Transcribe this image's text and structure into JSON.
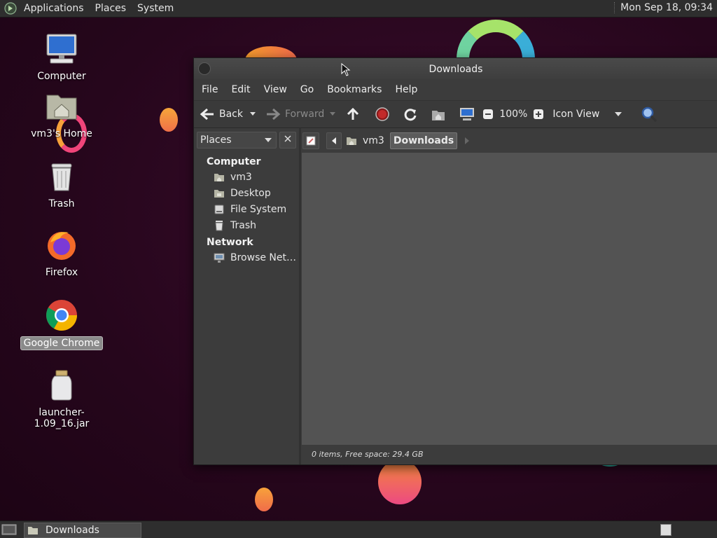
{
  "top_panel": {
    "menus": [
      "Applications",
      "Places",
      "System"
    ],
    "clock": "Mon Sep 18, 09:34"
  },
  "desktop": {
    "icons": [
      {
        "label": "Computer",
        "icon": "computer-icon"
      },
      {
        "label": "vm3's Home",
        "icon": "home-folder-icon"
      },
      {
        "label": "Trash",
        "icon": "trash-icon"
      },
      {
        "label": "Firefox",
        "icon": "firefox-icon"
      },
      {
        "label": "Google Chrome",
        "icon": "chrome-icon"
      },
      {
        "label": "launcher-1.09_16.jar",
        "icon": "jar-icon"
      }
    ]
  },
  "window": {
    "title": "Downloads",
    "menus": [
      "File",
      "Edit",
      "View",
      "Go",
      "Bookmarks",
      "Help"
    ],
    "toolbar": {
      "back": "Back",
      "forward": "Forward",
      "zoom": "100%",
      "view_mode": "Icon View"
    },
    "sidebar": {
      "selector": "Places",
      "sections": [
        {
          "heading": "Computer",
          "items": [
            "vm3",
            "Desktop",
            "File System",
            "Trash"
          ]
        },
        {
          "heading": "Network",
          "items": [
            "Browse Net…"
          ]
        }
      ]
    },
    "path": {
      "parent": "vm3",
      "current": "Downloads"
    },
    "status": "0 items, Free space: 29.4 GB"
  },
  "taskbar": {
    "task_label": "Downloads"
  },
  "colors": {
    "desktop_bg": "#26061c",
    "panel": "#2e2e2e",
    "window_bg": "#3c3c3c",
    "content_bg": "#535353"
  }
}
